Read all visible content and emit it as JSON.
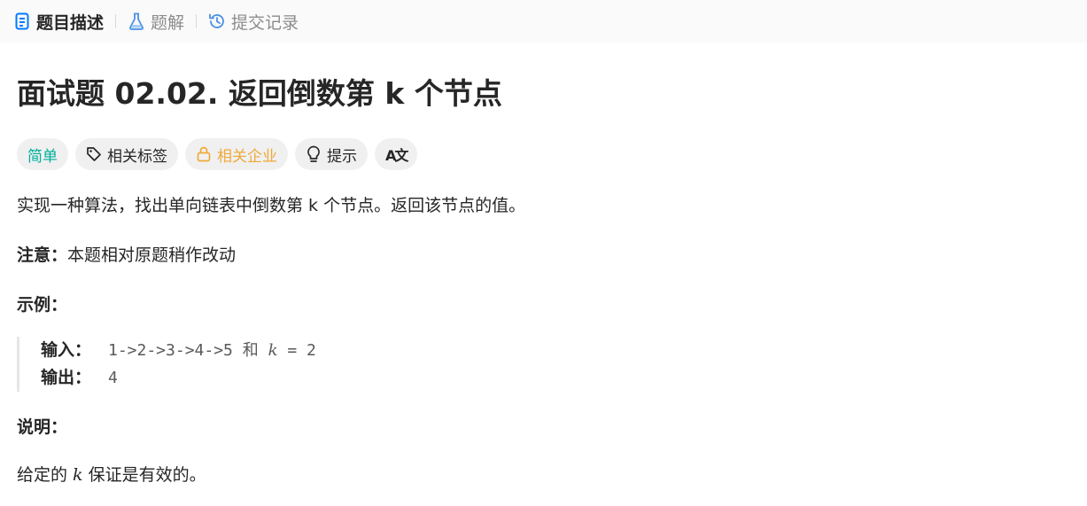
{
  "tabs": [
    {
      "label": "题目描述",
      "icon": "document-icon",
      "active": true
    },
    {
      "label": "题解",
      "icon": "flask-icon",
      "active": false
    },
    {
      "label": "提交记录",
      "icon": "history-icon",
      "active": false
    }
  ],
  "problem": {
    "title": "面试题 02.02. 返回倒数第 k 个节点",
    "tags": {
      "difficulty": "简单",
      "related_tags": "相关标签",
      "related_companies": "相关企业",
      "hint": "提示",
      "translate_icon_text": "A文"
    },
    "description": "实现一种算法，找出单向链表中倒数第 k 个节点。返回该节点的值。",
    "note_label": "注意：",
    "note_text": "本题相对原题稍作改动",
    "example_heading": "示例：",
    "example": {
      "input_label": "输入：",
      "input_value_prefix": "1->2->3->4->5 和 ",
      "input_var": "k",
      "input_value_suffix": " = 2",
      "output_label": "输出：",
      "output_value": "4"
    },
    "explain_heading": "说明：",
    "explain_prefix": "给定的 ",
    "explain_var": "k",
    "explain_suffix": " 保证是有效的。"
  },
  "colors": {
    "easy": "#00af9b",
    "company": "#f0a93b",
    "tab_active_icon": "#007aff"
  }
}
